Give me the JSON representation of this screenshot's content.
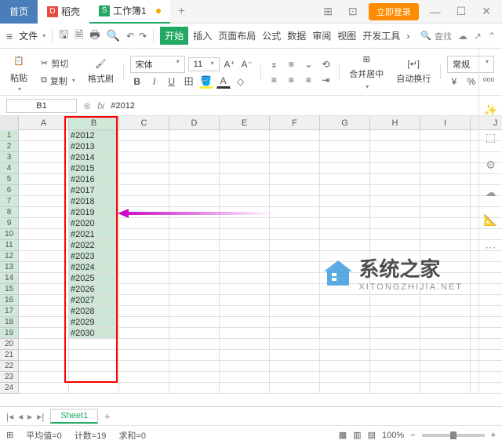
{
  "titlebar": {
    "home": "首页",
    "doc_tab": "稻壳",
    "active_tab": "工作簿1",
    "login": "立即登录"
  },
  "menubar": {
    "file": "文件",
    "tabs": {
      "start": "开始",
      "insert": "插入",
      "layout": "页面布局",
      "formula": "公式",
      "data": "数据",
      "review": "审阅",
      "view": "视图",
      "dev": "开发工具"
    },
    "search": "查找"
  },
  "ribbon": {
    "paste": "粘贴",
    "cut": "剪切",
    "copy": "复制",
    "format_painter": "格式刷",
    "font": "宋体",
    "size": "11",
    "merge": "合并居中",
    "wrap": "自动换行",
    "general": "常规"
  },
  "namebox": "B1",
  "formula": "#2012",
  "columns": [
    "A",
    "B",
    "C",
    "D",
    "E",
    "F",
    "G",
    "H",
    "I",
    "J"
  ],
  "row_numbers": [
    "1",
    "2",
    "3",
    "4",
    "5",
    "6",
    "7",
    "8",
    "9",
    "10",
    "11",
    "12",
    "13",
    "14",
    "15",
    "16",
    "17",
    "18",
    "19",
    "20",
    "21",
    "22",
    "23",
    "24"
  ],
  "cells_b": [
    "#2012",
    "#2013",
    "#2014",
    "#2015",
    "#2016",
    "#2017",
    "#2018",
    "#2019",
    "#2020",
    "#2021",
    "#2022",
    "#2023",
    "#2024",
    "#2025",
    "#2026",
    "#2027",
    "#2028",
    "#2029",
    "#2030"
  ],
  "sheet": "Sheet1",
  "status": {
    "avg": "平均值=0",
    "count": "计数=19",
    "sum": "求和=0",
    "zoom": "100%"
  },
  "watermark": {
    "title": "系统之家",
    "sub": "XITONGZHIJIA.NET"
  }
}
